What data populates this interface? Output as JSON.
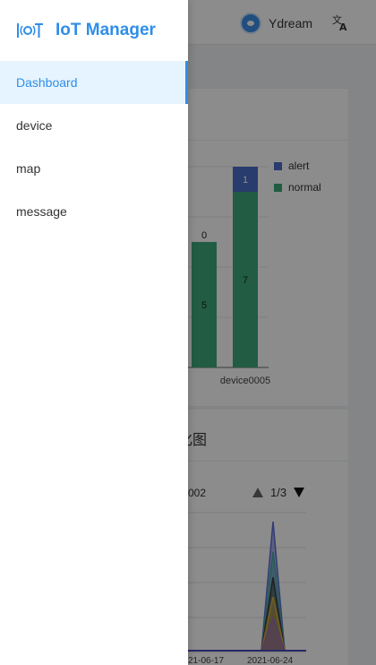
{
  "header": {
    "username": "Ydream",
    "avatar_icon": "avatar-icon",
    "language_icon": "translate-icon"
  },
  "drawer": {
    "brand_title": "IoT Manager",
    "logo_icon": "iot-logo-icon",
    "menu": [
      {
        "label": "Dashboard",
        "active": true
      },
      {
        "label": "device",
        "active": false
      },
      {
        "label": "map",
        "active": false
      },
      {
        "label": "message",
        "active": false
      }
    ]
  },
  "colors": {
    "accent": "#2f8ee8",
    "alert": "#4a6ec6",
    "normal": "#3da87a"
  },
  "chart_data": [
    {
      "type": "bar",
      "stacked": true,
      "categories": [
        "",
        "device0005"
      ],
      "series": [
        {
          "name": "normal",
          "values": [
            5,
            7
          ]
        },
        {
          "name": "alert",
          "values": [
            0,
            1
          ]
        }
      ],
      "legend": [
        "alert",
        "normal"
      ],
      "legend_position": "top-right",
      "ylim": [
        0,
        8
      ],
      "grid": true
    },
    {
      "type": "area",
      "title": "化图",
      "series_label": "002",
      "x_labels": [
        "21-06-17",
        "2021-06-24"
      ],
      "pager": "1/3",
      "grid": true
    }
  ]
}
